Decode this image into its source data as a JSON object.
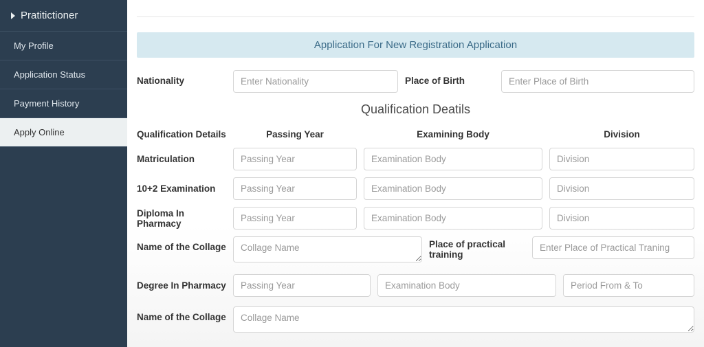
{
  "sidebar": {
    "header": "Pratitictioner",
    "items": [
      {
        "label": "My Profile",
        "active": false
      },
      {
        "label": "Application Status",
        "active": false
      },
      {
        "label": "Payment History",
        "active": false
      },
      {
        "label": "Apply Online",
        "active": true
      }
    ]
  },
  "banner": "Application For New Registration Application",
  "personal": {
    "nationality_label": "Nationality",
    "nationality_placeholder": "Enter Nationality",
    "pob_label": "Place of Birth",
    "pob_placeholder": "Enter Place of Birth"
  },
  "qual": {
    "section_title": "Qualification Deatils",
    "head": {
      "label": "Qualification Details",
      "c1": "Passing Year",
      "c2": "Examining Body",
      "c3": "Division"
    },
    "rows": [
      {
        "label": "Matriculation",
        "p1": "Passing Year",
        "p2": "Examination Body",
        "p3": "Division"
      },
      {
        "label": "10+2 Examination",
        "p1": "Passing Year",
        "p2": "Examination Body",
        "p3": "Division"
      },
      {
        "label": "Diploma In Pharmacy",
        "p1": "Passing Year",
        "p2": "Examination Body",
        "p3": "Division"
      }
    ],
    "collage1": {
      "label": "Name of the Collage",
      "placeholder": "Collage Name",
      "mid_label": "Place of practical training",
      "right_placeholder": "Enter Place of Practical Traning"
    },
    "degree": {
      "label": "Degree In Pharmacy",
      "p1": "Passing Year",
      "p2": "Examination Body",
      "p3": "Period From & To"
    },
    "collage2": {
      "label": "Name of the Collage",
      "placeholder": "Collage Name"
    }
  }
}
